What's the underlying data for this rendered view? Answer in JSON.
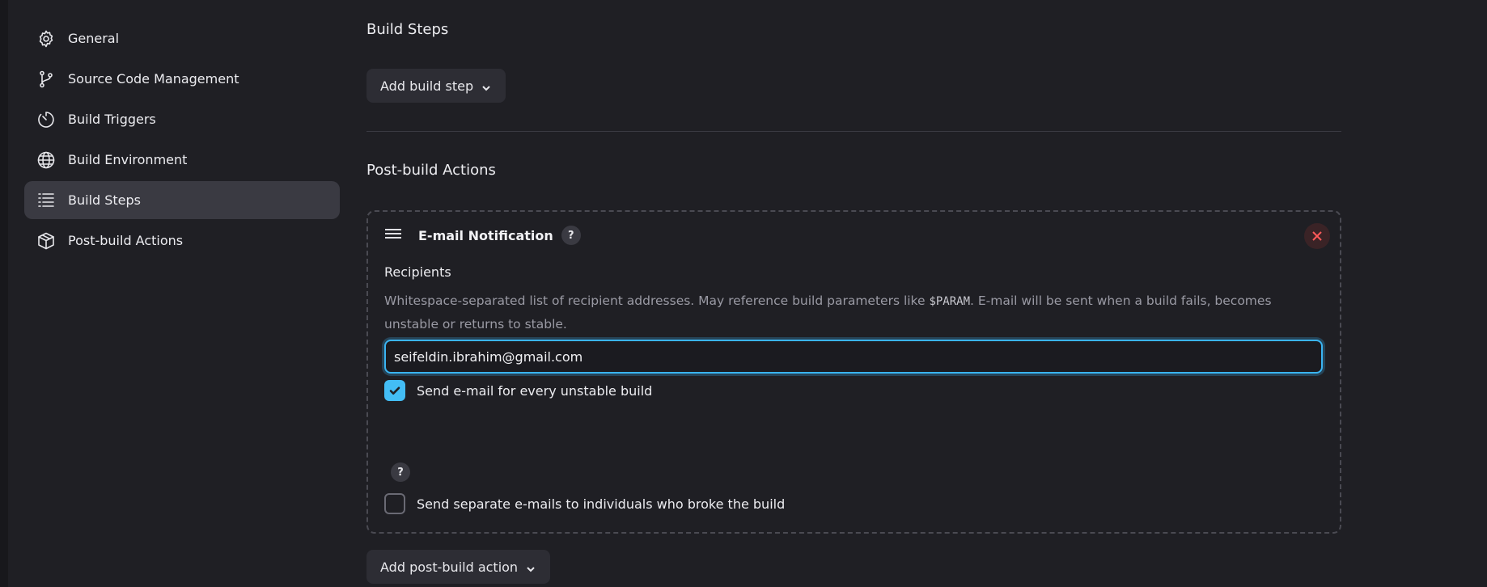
{
  "sidebar": {
    "items": [
      {
        "label": "General",
        "icon": "gear-icon",
        "active": false
      },
      {
        "label": "Source Code Management",
        "icon": "git-branch-icon",
        "active": false
      },
      {
        "label": "Build Triggers",
        "icon": "timer-icon",
        "active": false
      },
      {
        "label": "Build Environment",
        "icon": "globe-icon",
        "active": false
      },
      {
        "label": "Build Steps",
        "icon": "list-icon",
        "active": true
      },
      {
        "label": "Post-build Actions",
        "icon": "package-icon",
        "active": false
      }
    ]
  },
  "build_steps": {
    "title": "Build Steps",
    "add_button": "Add build step"
  },
  "post_build": {
    "title": "Post-build Actions",
    "add_button": "Add post-build action",
    "email_notification": {
      "title": "E-mail Notification",
      "help": "?",
      "recipients_label": "Recipients",
      "recipients_desc_before": "Whitespace-separated list of recipient addresses. May reference build parameters like ",
      "recipients_desc_code": "$PARAM",
      "recipients_desc_after": ". E-mail will be sent when a build fails, becomes unstable or returns to stable.",
      "recipients_value": "seifeldin.ibrahim@gmail.com",
      "checkbox_unstable_label": "Send e-mail for every unstable build",
      "checkbox_unstable_checked": true,
      "checkbox_separate_label": "Send separate e-mails to individuals who broke the build",
      "checkbox_separate_checked": false,
      "separate_help": "?"
    }
  },
  "colors": {
    "background": "#1f1f24",
    "active_nav": "#3a3a42",
    "accent": "#43bdf5",
    "danger": "#ff5a5a"
  }
}
